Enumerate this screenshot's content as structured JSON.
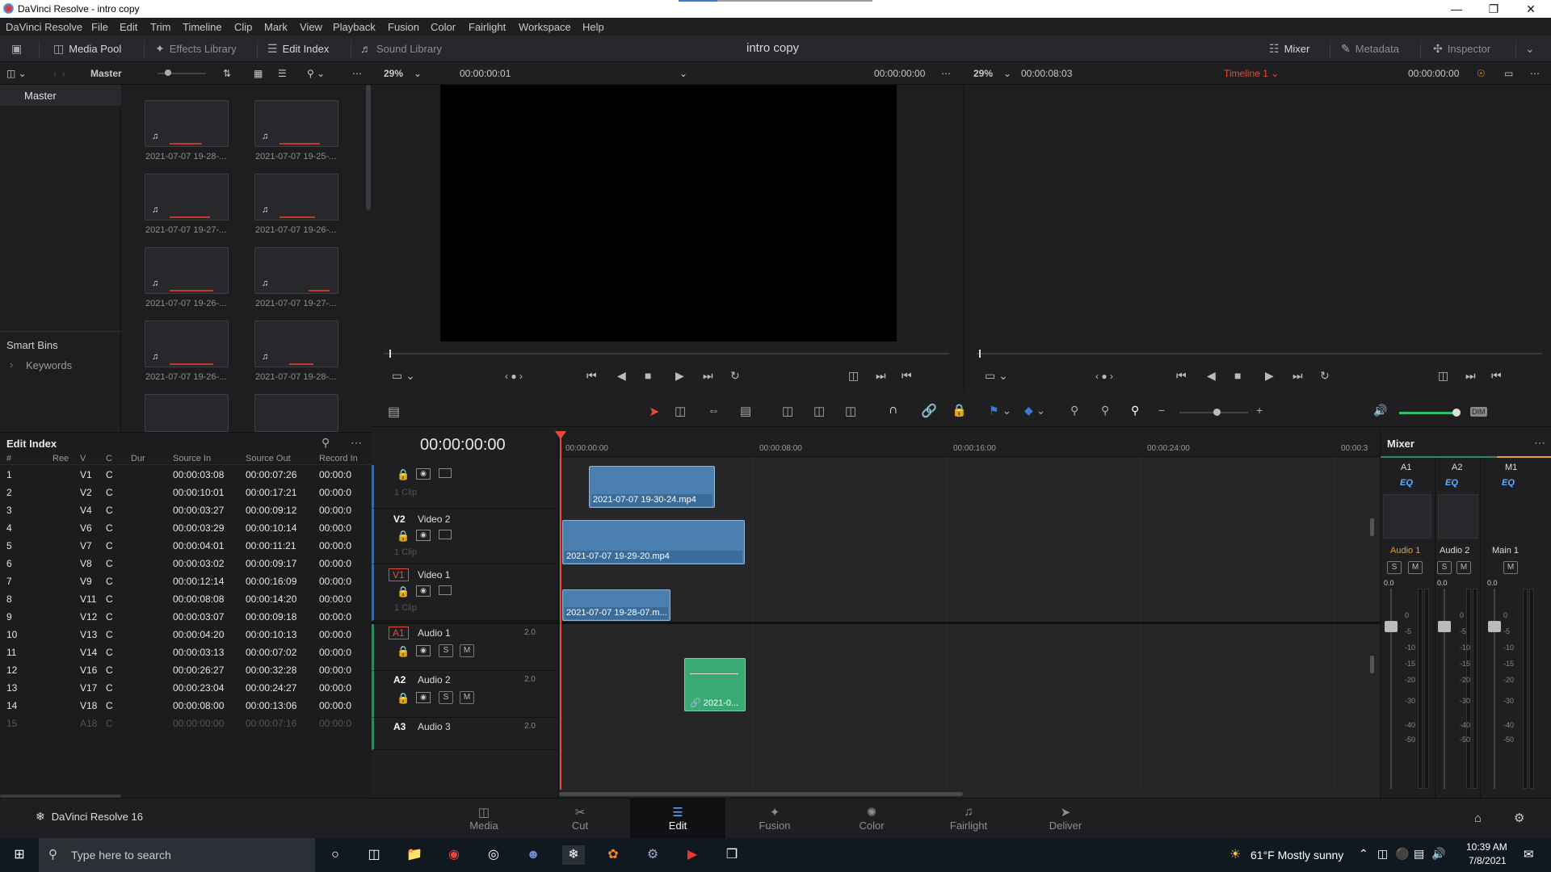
{
  "window": {
    "title": "DaVinci Resolve - intro copy"
  },
  "menu": [
    "DaVinci Resolve",
    "File",
    "Edit",
    "Trim",
    "Timeline",
    "Clip",
    "Mark",
    "View",
    "Playback",
    "Fusion",
    "Color",
    "Fairlight",
    "Workspace",
    "Help"
  ],
  "toolbar": {
    "media_pool": "Media Pool",
    "effects_library": "Effects Library",
    "edit_index": "Edit Index",
    "sound_library": "Sound Library",
    "project_title": "intro copy",
    "mixer": "Mixer",
    "metadata": "Metadata",
    "inspector": "Inspector"
  },
  "pool_bar": {
    "bin": "Master"
  },
  "source_bar": {
    "zoom": "29%",
    "timecode": "00:00:00:01",
    "duration": "00:00:00:00"
  },
  "program_bar": {
    "zoom": "29%",
    "timecode": "00:00:08:03",
    "timeline": "Timeline 1",
    "duration": "00:00:00:00"
  },
  "bins": {
    "master": "Master",
    "smart_bins": "Smart Bins",
    "keywords": "Keywords"
  },
  "media_clips": [
    "2021-07-07 19-28-...",
    "2021-07-07 19-25-...",
    "2021-07-07 19-27-...",
    "2021-07-07 19-26-...",
    "2021-07-07 19-26-...",
    "2021-07-07 19-27-...",
    "2021-07-07 19-26-...",
    "2021-07-07 19-28-..."
  ],
  "edit_index": {
    "title": "Edit Index",
    "columns": [
      "#",
      "Ree",
      "V",
      "C",
      "Dur",
      "Source In",
      "Source Out",
      "Record In"
    ],
    "rows": [
      [
        "1",
        "V1",
        "C",
        "00:00:03:08",
        "00:00:07:26",
        "00:00:0"
      ],
      [
        "2",
        "V2",
        "C",
        "00:00:10:01",
        "00:00:17:21",
        "00:00:0"
      ],
      [
        "3",
        "V4",
        "C",
        "00:00:03:27",
        "00:00:09:12",
        "00:00:0"
      ],
      [
        "4",
        "V6",
        "C",
        "00:00:03:29",
        "00:00:10:14",
        "00:00:0"
      ],
      [
        "5",
        "V7",
        "C",
        "00:00:04:01",
        "00:00:11:21",
        "00:00:0"
      ],
      [
        "6",
        "V8",
        "C",
        "00:00:03:02",
        "00:00:09:17",
        "00:00:0"
      ],
      [
        "7",
        "V9",
        "C",
        "00:00:12:14",
        "00:00:16:09",
        "00:00:0"
      ],
      [
        "8",
        "V11",
        "C",
        "00:00:08:08",
        "00:00:14:20",
        "00:00:0"
      ],
      [
        "9",
        "V12",
        "C",
        "00:00:03:07",
        "00:00:09:18",
        "00:00:0"
      ],
      [
        "10",
        "V13",
        "C",
        "00:00:04:20",
        "00:00:10:13",
        "00:00:0"
      ],
      [
        "11",
        "V14",
        "C",
        "00:00:03:13",
        "00:00:07:02",
        "00:00:0"
      ],
      [
        "12",
        "V16",
        "C",
        "00:00:26:27",
        "00:00:32:28",
        "00:00:0"
      ],
      [
        "13",
        "V17",
        "C",
        "00:00:23:04",
        "00:00:24:27",
        "00:00:0"
      ],
      [
        "14",
        "V18",
        "C",
        "00:00:08:00",
        "00:00:13:06",
        "00:00:0"
      ],
      [
        "15",
        "A18",
        "C",
        "00:00:00:00",
        "00:00:07:16",
        "00:00:0"
      ]
    ]
  },
  "timeline": {
    "timecode": "00:00:00:00",
    "ruler": [
      "00:00:00:00",
      "00:00:08:00",
      "00:00:16:00",
      "00:00:24:00",
      "00:00:3"
    ],
    "tracks": {
      "v3": {
        "count": "1 Clip"
      },
      "v2": {
        "id": "V2",
        "name": "Video 2",
        "count": "1 Clip"
      },
      "v1": {
        "id": "V1",
        "name": "Video 1",
        "count": "1 Clip"
      },
      "a1": {
        "id": "A1",
        "name": "Audio 1",
        "ch": "2.0"
      },
      "a2": {
        "id": "A2",
        "name": "Audio 2",
        "ch": "2.0"
      },
      "a3": {
        "id": "A3",
        "name": "Audio 3",
        "ch": "2.0"
      }
    },
    "clips": {
      "v3": "2021-07-07 19-30-24.mp4",
      "v2": "2021-07-07 19-29-20.mp4",
      "v1": "2021-07-07 19-28-07.m...",
      "a1": "2021-0..."
    }
  },
  "mixer": {
    "title": "Mixer",
    "channels": [
      {
        "id": "A1",
        "name": "Audio 1"
      },
      {
        "id": "A2",
        "name": "Audio 2"
      },
      {
        "id": "M1",
        "name": "Main 1"
      }
    ],
    "eq": "EQ",
    "solo": "S",
    "mute": "M",
    "level": "0.0",
    "scale": [
      "0",
      "-5",
      "-10",
      "-15",
      "-20",
      "-30",
      "-40",
      "-50"
    ],
    "accent": "#e8a020"
  },
  "track_btns": {
    "solo": "S",
    "mute": "M"
  },
  "dim": "DIM",
  "pages": [
    "Media",
    "Cut",
    "Edit",
    "Fusion",
    "Color",
    "Fairlight",
    "Deliver"
  ],
  "app_badge": "DaVinci Resolve 16",
  "taskbar": {
    "search": "Type here to search",
    "weather": "61°F  Mostly sunny",
    "time": "10:39 AM",
    "date": "7/8/2021"
  },
  "colors": {
    "playhead": "#e64b3c",
    "video_clip": "#4a7fb0",
    "audio_clip": "#3aaa75",
    "active_page": "#5ab0ff"
  }
}
